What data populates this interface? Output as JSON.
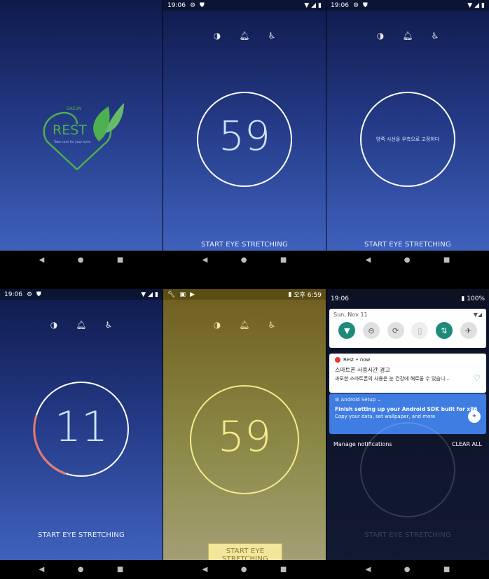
{
  "status": {
    "time": "19:06"
  },
  "logo": {
    "brand": "REST",
    "tag": "Take care for your eyes",
    "sub": "DAEUN"
  },
  "panels": {
    "p2": {
      "number": "59",
      "start_label": "START EYE STRETCHING"
    },
    "p3": {
      "message": "양쪽 시선을 우측으로 고정하다",
      "start_label": "START EYE STRETCHING"
    },
    "p4": {
      "number": "11",
      "start_label": "START EYE STRETCHING"
    },
    "p5": {
      "number": "59",
      "start_label": "START EYE STRETCHING",
      "status_time": "오후 6:59"
    },
    "p6": {
      "status_battery": "100%",
      "date": "Sun, Nov 11",
      "notif1": {
        "app": "Rest • now",
        "title": "스마트폰 사용시간 경고",
        "body": "과도한 스마트폰의 사용은 눈 건강에 해로울 수 있습니..."
      },
      "notif2": {
        "app": "Android Setup ⌄",
        "title": "Finish setting up your Android SDK built for x86",
        "body": "Copy your data, set wallpaper, and more"
      },
      "manage": "Manage notifications",
      "clear": "CLEAR ALL",
      "bg_label": "START EYE STRETCHING"
    }
  },
  "icons": [
    "contrast-icon",
    "bell-icon",
    "accessibility-icon",
    "back-icon",
    "home-icon",
    "recents-icon"
  ],
  "colors": {
    "accent_green": "#4caf50",
    "gold_ring": "#f6ea8d",
    "progress_red": "#e6776c",
    "notif_blue": "#3f7de3"
  }
}
